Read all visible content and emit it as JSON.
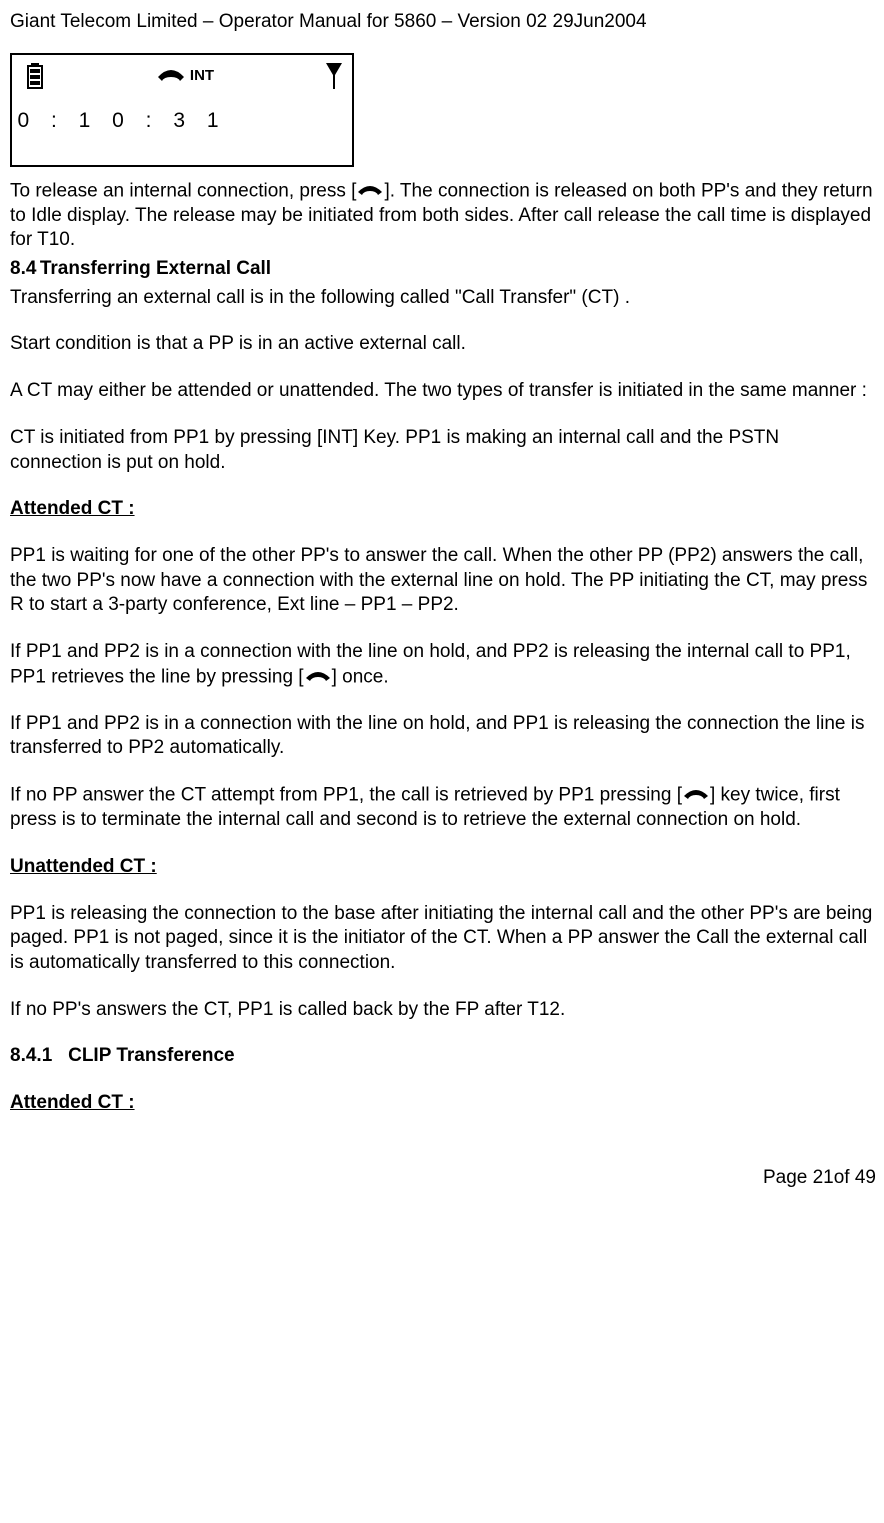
{
  "header": "Giant Telecom Limited – Operator Manual for 5860 – Version 02 29Jun2004",
  "lcd": {
    "int_label": "INT",
    "time": "0 : 1 0 : 3 1"
  },
  "p1a": "To release an internal connection, press [",
  "p1b": "]. The connection is released on both PP's and they return to Idle display. The release may be initiated from both sides. After call release the call time is displayed for T10.",
  "sec84_num": "8.4",
  "sec84_title": "Transferring External Call",
  "p2": "Transferring an external call is in the following called \"Call Transfer\" (CT) .",
  "p3": "Start condition is that a PP is in an active external call.",
  "p4": "A CT may either be attended or unattended. The two types of transfer is initiated in the same manner :",
  "p5": "CT is initiated from PP1 by pressing [INT] Key. PP1 is making an internal call and the PSTN connection is put on hold.",
  "h_attended": "Attended CT :",
  "p6": "PP1 is waiting for one of the other PP's to answer the call. When the other PP (PP2) answers the call, the two PP's now have a connection with the external line on hold. The PP initiating the CT, may press R to start a 3-party conference, Ext line – PP1 – PP2.",
  "p7a": "If PP1 and PP2 is in a connection with the line on hold, and PP2 is releasing the internal call to PP1, PP1 retrieves the line by pressing [",
  "p7b": "] once.",
  "p8": "If PP1 and PP2 is in a connection with the line on hold, and PP1 is releasing the connection the line is transferred to PP2 automatically.",
  "p9a": "If no PP answer the CT attempt from PP1, the call is retrieved by PP1 pressing [",
  "p9b": "] key twice, first press is to terminate the internal call and second is to retrieve the external connection on hold.",
  "h_unattended": "Unattended CT :",
  "p10": "PP1 is releasing the connection to the base after initiating the internal call and the other PP's are being paged. PP1 is not paged, since it is the initiator of the CT. When a PP answer the Call the external call is automatically transferred to this connection.",
  "p11": "If no PP's answers the CT, PP1 is called back by the FP after T12.",
  "sec841_num": "8.4.1",
  "sec841_title": "CLIP Transference",
  "h_attended2": "Attended CT :",
  "footer": "Page 21of 49"
}
